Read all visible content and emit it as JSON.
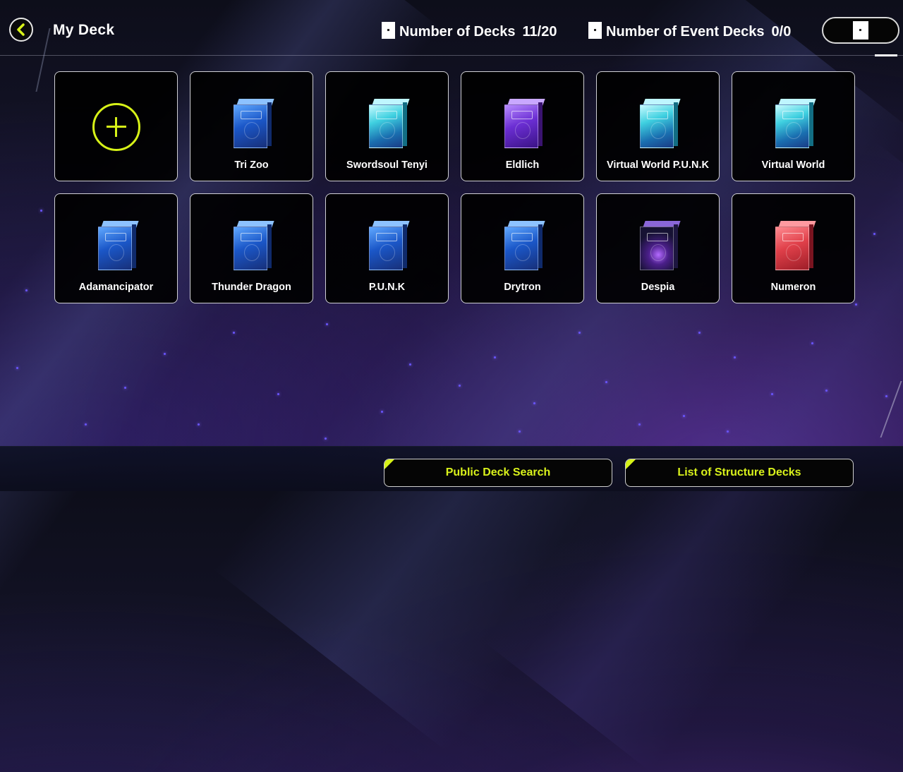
{
  "header": {
    "title": "My Deck",
    "back_icon": "chevron-left-icon",
    "deck_count_label": "Number of Decks",
    "deck_count_value": "11/20",
    "event_count_label": "Number of Event Decks",
    "event_count_value": "0/0"
  },
  "decks": [
    {
      "name": "Tri Zoo",
      "box": "blue"
    },
    {
      "name": "Swordsoul Tenyi",
      "box": "teal"
    },
    {
      "name": "Eldlich",
      "box": "purple"
    },
    {
      "name": "Virtual World P.U.N.K",
      "box": "teal"
    },
    {
      "name": "Virtual World",
      "box": "teal"
    },
    {
      "name": "Adamancipator",
      "box": "blue"
    },
    {
      "name": "Thunder Dragon",
      "box": "blue"
    },
    {
      "name": "P.U.N.K",
      "box": "blue"
    },
    {
      "name": "Drytron",
      "box": "blue"
    },
    {
      "name": "Despia",
      "box": "dark"
    },
    {
      "name": "Numeron",
      "box": "red"
    }
  ],
  "footer": {
    "public_search_label": "Public Deck Search",
    "structure_decks_label": "List of Structure Decks"
  },
  "colors": {
    "accent": "#d7f218",
    "tile_border": "#cfcfd4"
  }
}
